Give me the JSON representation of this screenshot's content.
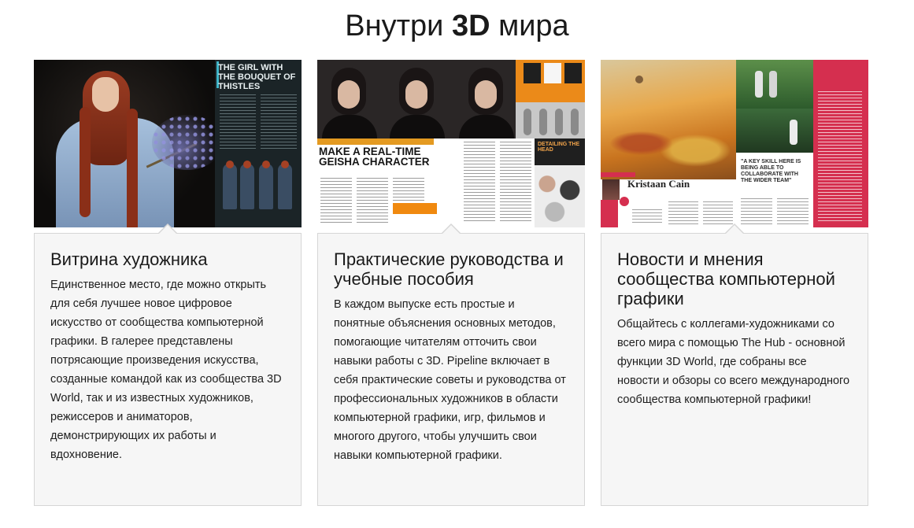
{
  "page": {
    "heading_prefix": "Внутри ",
    "heading_bold": "3D",
    "heading_suffix": " мира"
  },
  "cards": [
    {
      "title": "Витрина художника",
      "text": "Единственное место, где можно открыть для себя лучшее новое цифровое искусство от сообщества компьютерной графики. В галерее представлены потрясающие произведения искусства, созданные командой как из сообщества 3D World, так и из известных художников, режиссеров и аниматоров, демонстрирующих их работы и вдохновение.",
      "image": {
        "page_title": "THE GIRL WITH THE BOUQUET OF THISTLES"
      }
    },
    {
      "title": "Практические руководства и учебные пособия",
      "text": "В каждом выпуске есть простые и понятные объяснения основных методов, помогающие читателям отточить свои навыки работы с 3D. Pipeline включает в себя практические советы и руководства от профессиональных художников в области компьютерной графики, игр, фильмов и многого другого, чтобы улучшить свои навыки компьютерной графики.",
      "image": {
        "page_title": "MAKE A REAL-TIME GEISHA CHARACTER",
        "sidebar_title": "DETAILING THE HEAD"
      }
    },
    {
      "title": "Новости и мнения сообщества компьютерной графики",
      "text": "Общайтесь с коллегами-художниками со всего мира с помощью The Hub - основной функции 3D World, где собраны все новости и обзоры со всего международного сообщества компьютерной графики!",
      "image": {
        "name": "Kristaan Cain",
        "quote": "\"A KEY SKILL HERE IS BEING ABLE TO COLLABORATE WITH THE WIDER TEAM\""
      }
    }
  ]
}
